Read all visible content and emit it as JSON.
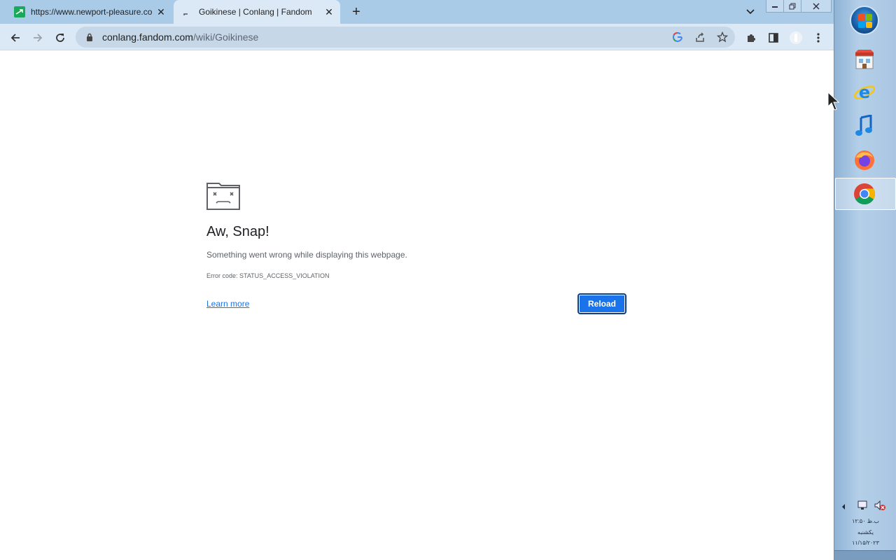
{
  "browser": {
    "tabs": [
      {
        "title": "https://www.newport-pleasure.co",
        "active": false,
        "favicon": "green-arrow-favicon"
      },
      {
        "title": "Goikinese | Conlang | Fandom",
        "active": true,
        "favicon": "fandom-favicon"
      }
    ],
    "new_tab_label": "+",
    "close_label": "✕",
    "url_host": "conlang.fandom.com",
    "url_path": "/wiki/Goikinese"
  },
  "error_page": {
    "heading": "Aw, Snap!",
    "message": "Something went wrong while displaying this webpage.",
    "error_code": "Error code: STATUS_ACCESS_VIOLATION",
    "learn_more": "Learn more",
    "reload": "Reload"
  },
  "taskbar": {
    "apps": [
      "start-orb",
      "store-icon",
      "internet-explorer-icon",
      "itunes-icon",
      "firefox-icon",
      "chrome-icon"
    ],
    "tray": {
      "time": "۱۲:۵۰ ب.ظ",
      "day": "یکشنبه",
      "date": "۱۱/۱۵/۲۰۲۳"
    }
  },
  "colors": {
    "tabstrip": "#a9cbe8",
    "toolbar": "#dbe9f6",
    "accent": "#1a73e8"
  }
}
